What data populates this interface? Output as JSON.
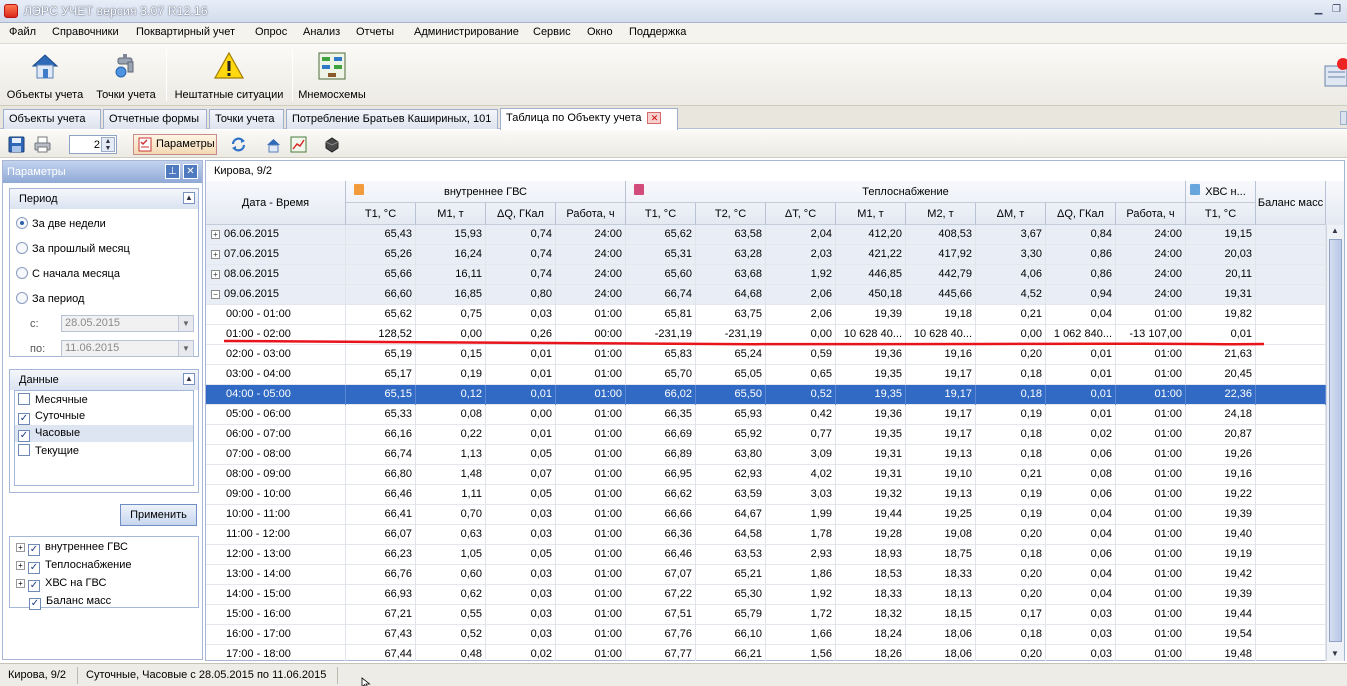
{
  "window": {
    "title": "ЛЭРС УЧЕТ версия 3.07 R12.16"
  },
  "menu": [
    "Файл",
    "Справочники",
    "Поквартирный учет",
    "Опрос",
    "Анализ",
    "Отчеты",
    "Администрирование",
    "Сервис",
    "Окно",
    "Поддержка"
  ],
  "ribbon": {
    "objects": "Объекты учета",
    "points": "Точки учета",
    "emergency": "Нештатные ситуации",
    "mnemo": "Мнемосхемы"
  },
  "tabs": [
    "Объекты учета",
    "Отчетные формы",
    "Точки учета",
    "Потребление Братьев Кашириных, 101",
    "Таблица по Объекту учета"
  ],
  "toolbar": {
    "spin_value": "2",
    "params_label": "Параметры"
  },
  "params": {
    "title": "Параметры",
    "period_title": "Период",
    "period_options": [
      "За две недели",
      "За прошлый месяц",
      "С начала месяца",
      "За период"
    ],
    "from_label": "с:",
    "from_value": "28.05.2015",
    "to_label": "по:",
    "to_value": "11.06.2015",
    "data_title": "Данные",
    "data_options": [
      {
        "label": "Месячные",
        "checked": false
      },
      {
        "label": "Суточные",
        "checked": true
      },
      {
        "label": "Часовые",
        "checked": true
      },
      {
        "label": "Текущие",
        "checked": false
      }
    ],
    "apply": "Применить",
    "tree": [
      "внутреннее ГВС",
      "Теплоснабжение",
      "ХВС на ГВС",
      "Баланс масс"
    ]
  },
  "grid": {
    "object": "Кирова, 9/2",
    "date_header": "Дата - Время",
    "groups": {
      "gvs": "внутреннее ГВС",
      "heat": "Теплоснабжение",
      "hvs": "ХВС н...",
      "balance": "Баланс масс"
    },
    "columns": [
      "Т1, °С",
      "М1, т",
      "ΔQ, ГКал",
      "Работа, ч",
      "Т1, °С",
      "Т2, °С",
      "ΔТ, °С",
      "М1, т",
      "М2, т",
      "ΔМ, т",
      "ΔQ, ГКал",
      "Работа, ч",
      "Т1, °С"
    ],
    "rows": [
      {
        "k": "daily",
        "exp": "+",
        "t": "06.06.2015",
        "v": [
          "65,43",
          "15,93",
          "0,74",
          "24:00",
          "65,62",
          "63,58",
          "2,04",
          "412,20",
          "408,53",
          "3,67",
          "0,84",
          "24:00",
          "19,15"
        ]
      },
      {
        "k": "daily",
        "exp": "+",
        "t": "07.06.2015",
        "v": [
          "65,26",
          "16,24",
          "0,74",
          "24:00",
          "65,31",
          "63,28",
          "2,03",
          "421,22",
          "417,92",
          "3,30",
          "0,86",
          "24:00",
          "20,03"
        ]
      },
      {
        "k": "daily",
        "exp": "+",
        "t": "08.06.2015",
        "v": [
          "65,66",
          "16,11",
          "0,74",
          "24:00",
          "65,60",
          "63,68",
          "1,92",
          "446,85",
          "442,79",
          "4,06",
          "0,86",
          "24:00",
          "20,11"
        ]
      },
      {
        "k": "daily",
        "exp": "−",
        "t": "09.06.2015",
        "v": [
          "66,60",
          "16,85",
          "0,80",
          "24:00",
          "66,74",
          "64,68",
          "2,06",
          "450,18",
          "445,66",
          "4,52",
          "0,94",
          "24:00",
          "19,31"
        ]
      },
      {
        "k": "hour",
        "t": "00:00 - 01:00",
        "v": [
          "65,62",
          "0,75",
          "0,03",
          "01:00",
          "65,81",
          "63,75",
          "2,06",
          "19,39",
          "19,18",
          "0,21",
          "0,04",
          "01:00",
          "19,82"
        ]
      },
      {
        "k": "hour",
        "t": "01:00 - 02:00",
        "v": [
          "128,52",
          "0,00",
          "0,26",
          "00:00",
          "-231,19",
          "-231,19",
          "0,00",
          "10 628 40...",
          "10 628 40...",
          "0,00",
          "1 062 840...",
          "-13 107,00",
          "0,01"
        ]
      },
      {
        "k": "hour",
        "t": "02:00 - 03:00",
        "v": [
          "65,19",
          "0,15",
          "0,01",
          "01:00",
          "65,83",
          "65,24",
          "0,59",
          "19,36",
          "19,16",
          "0,20",
          "0,01",
          "01:00",
          "21,63"
        ]
      },
      {
        "k": "hour",
        "t": "03:00 - 04:00",
        "v": [
          "65,17",
          "0,19",
          "0,01",
          "01:00",
          "65,70",
          "65,05",
          "0,65",
          "19,35",
          "19,17",
          "0,18",
          "0,01",
          "01:00",
          "20,45"
        ]
      },
      {
        "k": "sel",
        "t": "04:00 - 05:00",
        "v": [
          "65,15",
          "0,12",
          "0,01",
          "01:00",
          "66,02",
          "65,50",
          "0,52",
          "19,35",
          "19,17",
          "0,18",
          "0,01",
          "01:00",
          "22,36"
        ]
      },
      {
        "k": "hour",
        "t": "05:00 - 06:00",
        "v": [
          "65,33",
          "0,08",
          "0,00",
          "01:00",
          "66,35",
          "65,93",
          "0,42",
          "19,36",
          "19,17",
          "0,19",
          "0,01",
          "01:00",
          "24,18"
        ]
      },
      {
        "k": "hour",
        "t": "06:00 - 07:00",
        "v": [
          "66,16",
          "0,22",
          "0,01",
          "01:00",
          "66,69",
          "65,92",
          "0,77",
          "19,35",
          "19,17",
          "0,18",
          "0,02",
          "01:00",
          "20,87"
        ]
      },
      {
        "k": "hour",
        "t": "07:00 - 08:00",
        "v": [
          "66,74",
          "1,13",
          "0,05",
          "01:00",
          "66,89",
          "63,80",
          "3,09",
          "19,31",
          "19,13",
          "0,18",
          "0,06",
          "01:00",
          "19,26"
        ]
      },
      {
        "k": "hour",
        "t": "08:00 - 09:00",
        "v": [
          "66,80",
          "1,48",
          "0,07",
          "01:00",
          "66,95",
          "62,93",
          "4,02",
          "19,31",
          "19,10",
          "0,21",
          "0,08",
          "01:00",
          "19,16"
        ]
      },
      {
        "k": "hour",
        "t": "09:00 - 10:00",
        "v": [
          "66,46",
          "1,11",
          "0,05",
          "01:00",
          "66,62",
          "63,59",
          "3,03",
          "19,32",
          "19,13",
          "0,19",
          "0,06",
          "01:00",
          "19,22"
        ]
      },
      {
        "k": "hour",
        "t": "10:00 - 11:00",
        "v": [
          "66,41",
          "0,70",
          "0,03",
          "01:00",
          "66,66",
          "64,67",
          "1,99",
          "19,44",
          "19,25",
          "0,19",
          "0,04",
          "01:00",
          "19,39"
        ]
      },
      {
        "k": "hour",
        "t": "11:00 - 12:00",
        "v": [
          "66,07",
          "0,63",
          "0,03",
          "01:00",
          "66,36",
          "64,58",
          "1,78",
          "19,28",
          "19,08",
          "0,20",
          "0,04",
          "01:00",
          "19,40"
        ]
      },
      {
        "k": "hour",
        "t": "12:00 - 13:00",
        "v": [
          "66,23",
          "1,05",
          "0,05",
          "01:00",
          "66,46",
          "63,53",
          "2,93",
          "18,93",
          "18,75",
          "0,18",
          "0,06",
          "01:00",
          "19,19"
        ]
      },
      {
        "k": "hour",
        "t": "13:00 - 14:00",
        "v": [
          "66,76",
          "0,60",
          "0,03",
          "01:00",
          "67,07",
          "65,21",
          "1,86",
          "18,53",
          "18,33",
          "0,20",
          "0,04",
          "01:00",
          "19,42"
        ]
      },
      {
        "k": "hour",
        "t": "14:00 - 15:00",
        "v": [
          "66,93",
          "0,62",
          "0,03",
          "01:00",
          "67,22",
          "65,30",
          "1,92",
          "18,33",
          "18,13",
          "0,20",
          "0,04",
          "01:00",
          "19,39"
        ]
      },
      {
        "k": "hour",
        "t": "15:00 - 16:00",
        "v": [
          "67,21",
          "0,55",
          "0,03",
          "01:00",
          "67,51",
          "65,79",
          "1,72",
          "18,32",
          "18,15",
          "0,17",
          "0,03",
          "01:00",
          "19,44"
        ]
      },
      {
        "k": "hour",
        "t": "16:00 - 17:00",
        "v": [
          "67,43",
          "0,52",
          "0,03",
          "01:00",
          "67,76",
          "66,10",
          "1,66",
          "18,24",
          "18,06",
          "0,18",
          "0,03",
          "01:00",
          "19,54"
        ]
      },
      {
        "k": "hour",
        "t": "17:00 - 18:00",
        "v": [
          "67,44",
          "0,48",
          "0,02",
          "01:00",
          "67,77",
          "66,21",
          "1,56",
          "18,26",
          "18,06",
          "0,20",
          "0,03",
          "01:00",
          "19,48"
        ]
      }
    ]
  },
  "status": {
    "object": "Кирова, 9/2",
    "range": "Суточные, Часовые с 28.05.2015 по 11.06.2015"
  },
  "colors": {
    "selection": "#316ac5",
    "annotation": "#e8141c",
    "panel_header": "#8fa9d6"
  }
}
